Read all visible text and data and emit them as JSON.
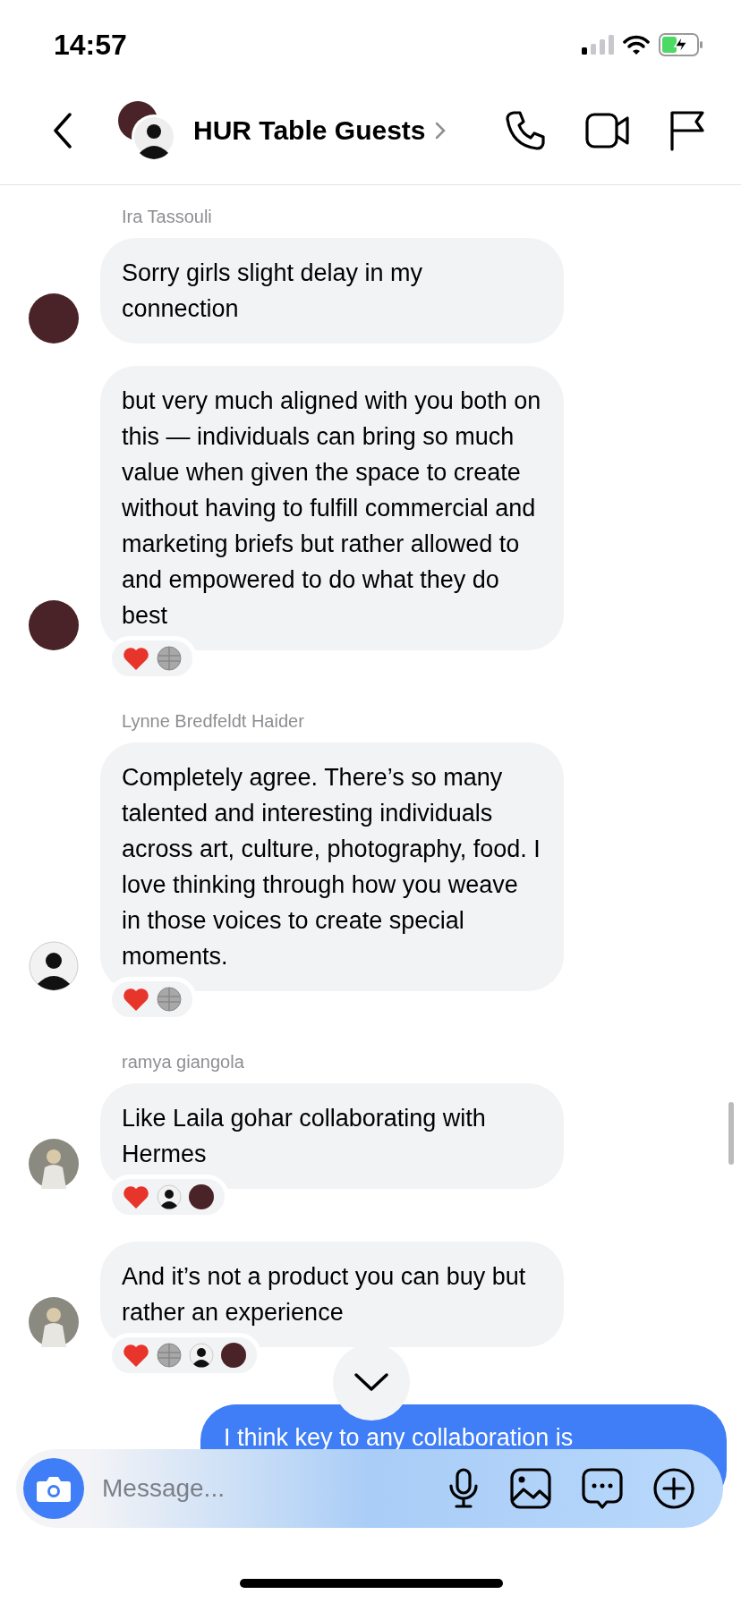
{
  "status_bar": {
    "time": "14:57"
  },
  "header": {
    "title": "HUR Table Guests"
  },
  "messages": [
    {
      "sender": "Ira Tassouli",
      "avatar": {
        "kind": "maroon"
      },
      "text": "Sorry girls slight delay in my connection"
    },
    {
      "avatar": {
        "kind": "maroon"
      },
      "text": "but very much aligned with you both on this — individuals can bring so much value when given the space to create without having to fulfill commercial and marketing briefs but rather allowed to and empowered to do what they do best",
      "reactions": [
        {
          "kind": "heart"
        },
        {
          "kind": "grey"
        }
      ]
    },
    {
      "sender": "Lynne Bredfeldt Haider",
      "avatar": {
        "kind": "portrait"
      },
      "text": "Completely agree. There’s so many talented and interesting individuals across art, culture, photography, food. I love thinking through how you weave in those voices to create special moments.",
      "reactions": [
        {
          "kind": "heart"
        },
        {
          "kind": "grey"
        }
      ]
    },
    {
      "sender": "ramya giangola",
      "avatar": {
        "kind": "figure"
      },
      "text": "Like Laila gohar collaborating with Hermes",
      "reactions": [
        {
          "kind": "heart"
        },
        {
          "kind": "portrait"
        },
        {
          "kind": "maroon"
        }
      ]
    },
    {
      "avatar": {
        "kind": "figure"
      },
      "text": "And it’s not a product you can buy but rather an experience",
      "reactions": [
        {
          "kind": "heart"
        },
        {
          "kind": "grey"
        },
        {
          "kind": "portrait"
        },
        {
          "kind": "maroon"
        }
      ]
    }
  ],
  "outgoing": {
    "text": "I think key to any collaboration is"
  },
  "composer": {
    "placeholder": "Message..."
  }
}
